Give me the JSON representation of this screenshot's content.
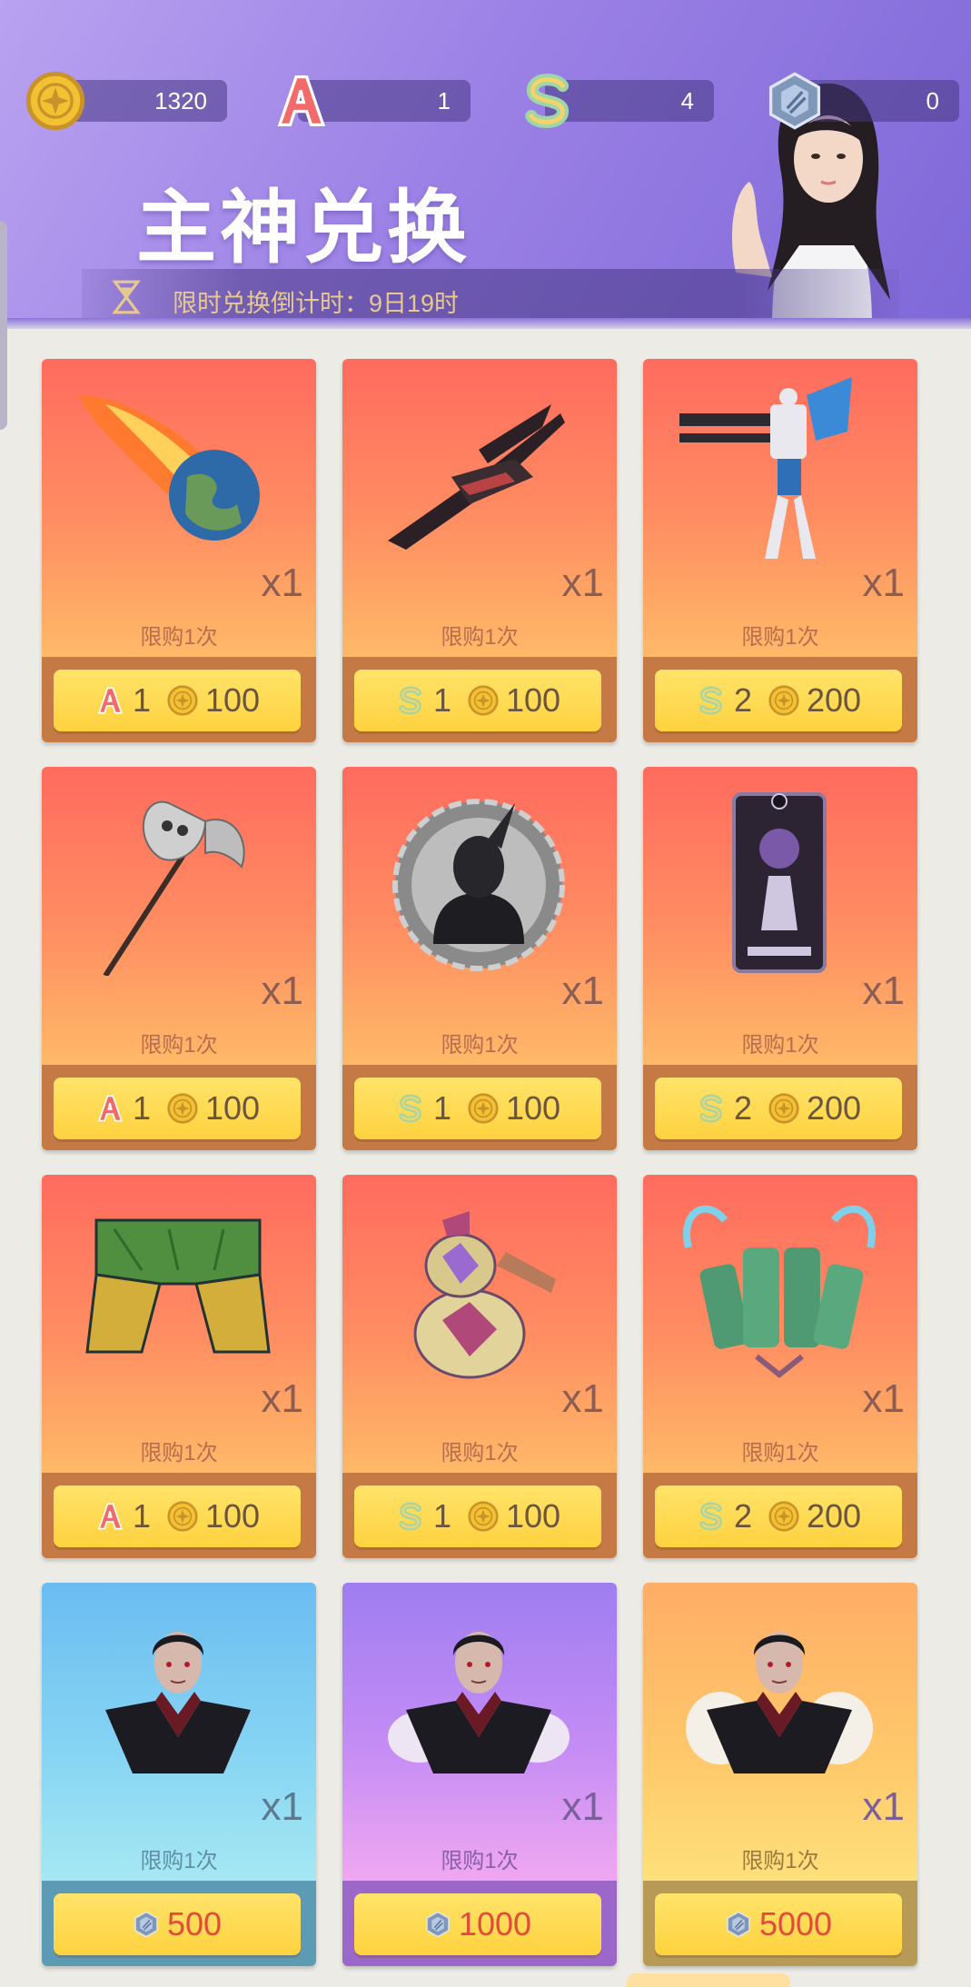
{
  "currencies": {
    "gold": {
      "icon": "gold-coin-icon",
      "value": "1320"
    },
    "a_ticket": {
      "icon": "letter-a-icon",
      "value": "1"
    },
    "s_ticket": {
      "icon": "letter-s-icon",
      "value": "4"
    },
    "crystal": {
      "icon": "blue-crystal-icon",
      "value": "0"
    }
  },
  "header": {
    "title": "主神兑换",
    "countdown": "限时兑换倒计时：9日19时"
  },
  "items": [
    {
      "art": "meteor-earth",
      "qty": "x1",
      "limit": "限购1次",
      "costs": [
        {
          "icon": "letter-a-icon",
          "value": "1"
        },
        {
          "icon": "gold-coin-icon",
          "value": "100"
        }
      ]
    },
    {
      "art": "spaceship",
      "qty": "x1",
      "limit": "限购1次",
      "costs": [
        {
          "icon": "letter-s-icon",
          "value": "1"
        },
        {
          "icon": "gold-coin-icon",
          "value": "100"
        }
      ]
    },
    {
      "art": "mecha-robot",
      "qty": "x1",
      "limit": "限购1次",
      "costs": [
        {
          "icon": "letter-s-icon",
          "value": "2"
        },
        {
          "icon": "gold-coin-icon",
          "value": "200"
        }
      ]
    },
    {
      "art": "skull-axe",
      "qty": "x1",
      "limit": "限购1次",
      "costs": [
        {
          "icon": "letter-a-icon",
          "value": "1"
        },
        {
          "icon": "gold-coin-icon",
          "value": "100"
        }
      ]
    },
    {
      "art": "dark-knight-medallion",
      "qty": "x1",
      "limit": "限购1次",
      "costs": [
        {
          "icon": "letter-s-icon",
          "value": "1"
        },
        {
          "icon": "gold-coin-icon",
          "value": "100"
        }
      ]
    },
    {
      "art": "tarot-card",
      "qty": "x1",
      "limit": "限购1次",
      "costs": [
        {
          "icon": "letter-s-icon",
          "value": "2"
        },
        {
          "icon": "gold-coin-icon",
          "value": "200"
        }
      ]
    },
    {
      "art": "leaf-pants",
      "qty": "x1",
      "limit": "限购1次",
      "costs": [
        {
          "icon": "letter-a-icon",
          "value": "1"
        },
        {
          "icon": "gold-coin-icon",
          "value": "100"
        }
      ]
    },
    {
      "art": "gourd-flask",
      "qty": "x1",
      "limit": "限购1次",
      "costs": [
        {
          "icon": "letter-s-icon",
          "value": "1"
        },
        {
          "icon": "gold-coin-icon",
          "value": "100"
        }
      ]
    },
    {
      "art": "jade-armor",
      "qty": "x1",
      "limit": "限购1次",
      "costs": [
        {
          "icon": "letter-s-icon",
          "value": "2"
        },
        {
          "icon": "gold-coin-icon",
          "value": "200"
        }
      ]
    },
    {
      "art": "vampire-bust",
      "qty": "x1",
      "limit": "限购1次",
      "costs": [
        {
          "icon": "blue-crystal-icon",
          "value": "500"
        }
      ]
    },
    {
      "art": "vampire-bust",
      "qty": "x1",
      "limit": "限购1次",
      "costs": [
        {
          "icon": "blue-crystal-icon",
          "value": "1000"
        }
      ]
    },
    {
      "art": "vampire-bust",
      "qty": "x1",
      "limit": "限购1次",
      "costs": [
        {
          "icon": "blue-crystal-icon",
          "value": "5000"
        }
      ]
    }
  ],
  "colors": {
    "header": "#9c82e6",
    "card_red": "#ff6b5e",
    "card_blue": "#6bbcf2",
    "card_purple": "#9f7df0",
    "card_yellow": "#ffc96b",
    "price_button": "#ffd23f",
    "price_red": "#e24a3b"
  }
}
